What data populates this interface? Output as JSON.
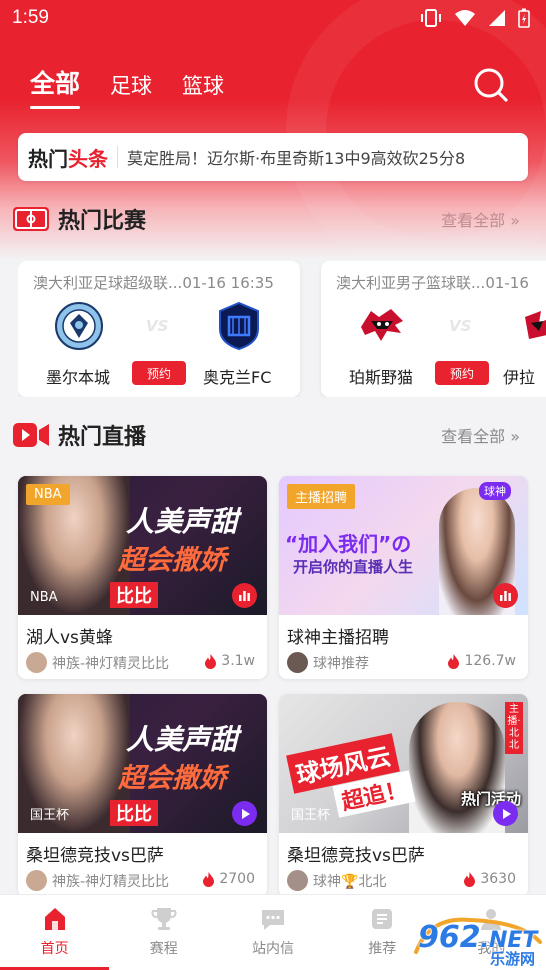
{
  "status_bar": {
    "time": "1:59"
  },
  "top_tabs": [
    {
      "label": "全部",
      "active": true
    },
    {
      "label": "足球",
      "active": false
    },
    {
      "label": "篮球",
      "active": false
    }
  ],
  "headline": {
    "badge_black": "热门",
    "badge_red": "头条",
    "text": "莫定胜局！迈尔斯·布里奇斯13中9高效砍25分8"
  },
  "hot_matches": {
    "title": "热门比赛",
    "more": "查看全部 »",
    "matches": [
      {
        "league": "澳大利亚足球超级联...",
        "time": "01-16 16:35",
        "home": "墨尔本城",
        "away": "奥克兰FC",
        "vs": "VS",
        "action": "预约"
      },
      {
        "league": "澳大利亚男子篮球联...",
        "time": "01-16",
        "home": "珀斯野猫",
        "away": "伊拉",
        "vs": "VS",
        "action": "预约"
      }
    ]
  },
  "hot_live": {
    "title": "热门直播",
    "more": "查看全部 »",
    "cards": [
      {
        "tag": "NBA",
        "thumb_big": "人美声甜",
        "thumb_sub": "超会撒娇",
        "thumb_name": "比比",
        "league": "NBA",
        "title": "湖人vs黄蜂",
        "anchor": "神族-神灯精灵比比",
        "heat": "3.1w",
        "badge": "red"
      },
      {
        "tag": "主播招聘",
        "thumb_big": "“加入我们”の",
        "thumb_sub": "开启你的直播人生",
        "thumb_name": "球神",
        "league": "",
        "title": "球神主播招聘",
        "anchor": "球神推荐",
        "heat": "126.7w",
        "badge": "red"
      },
      {
        "tag": "",
        "thumb_big": "人美声甜",
        "thumb_sub": "超会撒娇",
        "thumb_name": "比比",
        "league": "国王杯",
        "title": "桑坦德竞技vs巴萨",
        "anchor": "神族-神灯精灵比比",
        "heat": "2700",
        "badge": "purple"
      },
      {
        "tag": "",
        "thumb_big": "球场风云",
        "thumb_sub": "超追！",
        "thumb_name": "主播·北北",
        "league": "国王杯",
        "title": "桑坦德竞技vs巴萨",
        "anchor": "球神🏆北北",
        "heat": "3630",
        "badge": "purple",
        "overlay": "热门活动"
      }
    ]
  },
  "bottom_nav": [
    {
      "label": "首页",
      "icon": "home-icon",
      "active": true
    },
    {
      "label": "赛程",
      "icon": "trophy-icon",
      "active": false
    },
    {
      "label": "站内信",
      "icon": "message-icon",
      "active": false
    },
    {
      "label": "推荐",
      "icon": "recommend-icon",
      "active": false
    },
    {
      "label": "我的",
      "icon": "profile-icon",
      "active": false
    }
  ],
  "watermark": {
    "brand": "962",
    "suffix": ".NET",
    "sub": "乐游网"
  },
  "colors": {
    "primary": "#e8222e",
    "muted": "#8a8a8a",
    "background": "#f3f3f5"
  }
}
